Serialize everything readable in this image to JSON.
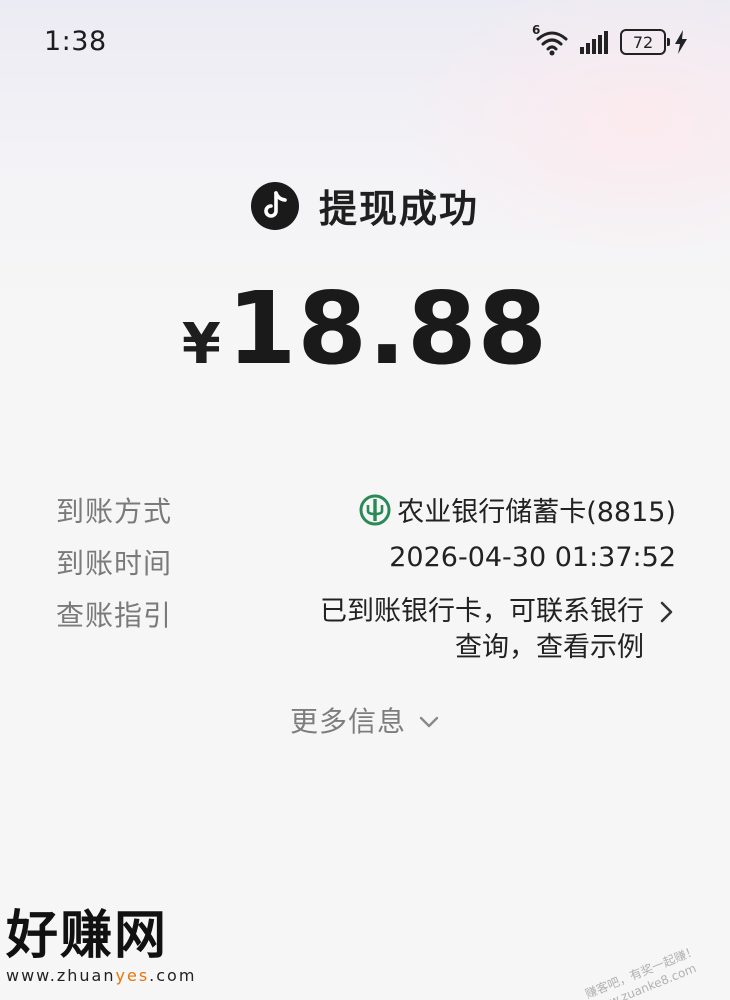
{
  "status_bar": {
    "time": "1:38",
    "network_label": "6",
    "battery_level": "72"
  },
  "header": {
    "title": "提现成功",
    "brand_icon": "douyin-icon"
  },
  "amount": {
    "currency": "¥",
    "value": "18.88"
  },
  "details": {
    "method": {
      "label": "到账方式",
      "value": "农业银行储蓄卡(8815)"
    },
    "time": {
      "label": "到账时间",
      "value": "2026-04-30 01:37:52"
    },
    "guide": {
      "label": "查账指引",
      "line1": "已到账银行卡，可联系银行",
      "line2": "查询，查看示例"
    }
  },
  "more_info": {
    "label": "更多信息"
  },
  "watermark": {
    "logo_text": "好赚网",
    "url_prefix": "www.zhuan",
    "url_highlight": "yes",
    "url_suffix": ".com",
    "right_line1": "赚客吧，有奖一起赚！",
    "right_line2": "www.zuanke8.com"
  },
  "colors": {
    "bank_green": "#2a8a55",
    "text_dark": "#1e1e1e",
    "text_muted": "#7a7a7a",
    "watermark_accent": "#e8740c"
  }
}
